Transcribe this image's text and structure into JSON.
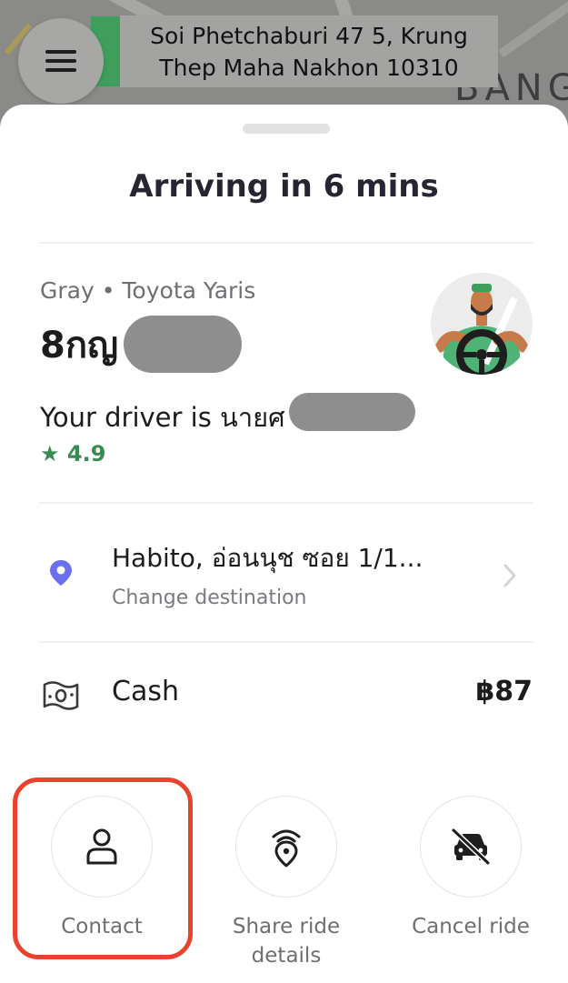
{
  "map": {
    "menu_icon": "hamburger-menu-icon",
    "pickup_address": "Soi Phetchaburi 47 5, Krung Thep Maha Nakhon 10310",
    "map_label": "BANG"
  },
  "trip": {
    "status": "Arriving in 6 mins",
    "car_description": "Gray • Toyota Yaris",
    "plate_partial": "8กญ",
    "driver_line": "Your driver is นายศ",
    "rating": "★ 4.9"
  },
  "destination": {
    "title": "Habito, อ่อนนุช ซอย 1/1...",
    "subtitle": "Change destination",
    "icon": "location-pin-icon"
  },
  "payment": {
    "method": "Cash",
    "amount": "฿87",
    "icon": "cash-icon"
  },
  "actions": [
    {
      "label": "Contact",
      "icon": "person-icon"
    },
    {
      "label": "Share ride details",
      "icon": "share-location-icon"
    },
    {
      "label": "Cancel ride",
      "icon": "car-cancel-icon"
    }
  ],
  "colors": {
    "accent_green": "#3a8a55",
    "highlight": "#e8432d",
    "pin": "#6a6ff2"
  }
}
